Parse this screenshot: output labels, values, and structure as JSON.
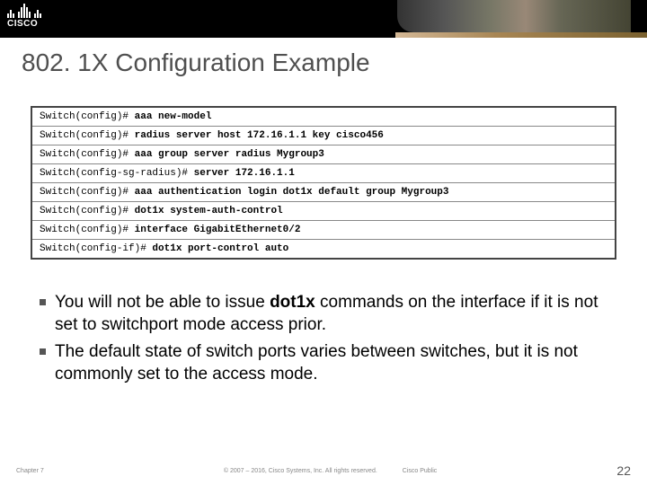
{
  "logo_text": "CISCO",
  "title": "802. 1X Configuration Example",
  "code_lines": [
    {
      "prompt": "Switch(config)# ",
      "cmd": "aaa new-model"
    },
    {
      "prompt": "Switch(config)# ",
      "cmd": "radius server host 172.16.1.1 key cisco456"
    },
    {
      "prompt": "Switch(config)# ",
      "cmd": "aaa group server radius Mygroup3"
    },
    {
      "prompt": "Switch(config-sg-radius)# ",
      "cmd": "server 172.16.1.1"
    },
    {
      "prompt": "Switch(config)# ",
      "cmd": "aaa authentication login dot1x default group Mygroup3"
    },
    {
      "prompt": "Switch(config)# ",
      "cmd": "dot1x system-auth-control"
    },
    {
      "prompt": "Switch(config)# ",
      "cmd": "interface GigabitEthernet0/2"
    },
    {
      "prompt": "Switch(config-if)# ",
      "cmd": "dot1x port-control auto"
    }
  ],
  "bullets": [
    {
      "pre": "You will not be able to issue ",
      "bold": "dot1x",
      "post": " commands on the interface if it is not set to switchport mode access prior."
    },
    {
      "pre": "The default state of switch ports varies between switches, but it is not commonly set to the access mode.",
      "bold": "",
      "post": ""
    }
  ],
  "footer": {
    "chapter": "Chapter 7",
    "copyright": "© 2007 – 2016, Cisco Systems, Inc. All rights reserved.",
    "classification": "Cisco Public",
    "page": "22"
  }
}
